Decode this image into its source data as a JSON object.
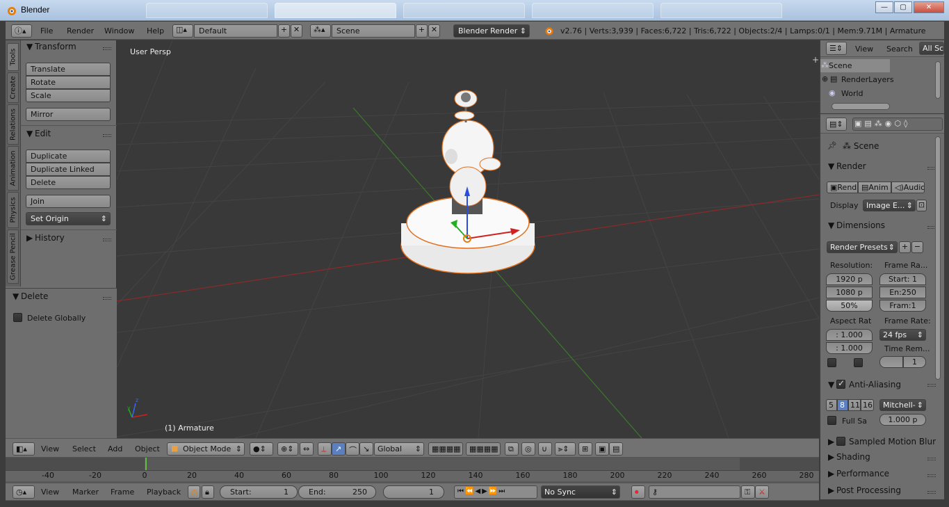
{
  "window": {
    "title": "Blender",
    "min": "—",
    "max": "▢",
    "close": "✕"
  },
  "infobar": {
    "menus": [
      "File",
      "Render",
      "Window",
      "Help"
    ],
    "layout": "Default",
    "scene": "Scene",
    "engine": "Blender Render",
    "stats": "v2.76 | Verts:3,939 | Faces:6,722 | Tris:6,722 | Objects:2/4 | Lamps:0/1 | Mem:9.71M | Armature"
  },
  "tool_tabs": [
    "Tools",
    "Create",
    "Relations",
    "Animation",
    "Physics",
    "Grease Pencil"
  ],
  "tools": {
    "transform_title": "Transform",
    "translate": "Translate",
    "rotate": "Rotate",
    "scale": "Scale",
    "mirror": "Mirror",
    "edit_title": "Edit",
    "duplicate": "Duplicate",
    "duplicate_linked": "Duplicate Linked",
    "delete": "Delete",
    "join": "Join",
    "set_origin": "Set Origin",
    "history_title": "History"
  },
  "operator": {
    "title": "Delete",
    "delete_globally": "Delete Globally"
  },
  "viewport": {
    "view_label": "User Persp",
    "selection": "(1) Armature"
  },
  "view3d_header": {
    "menus": [
      "View",
      "Select",
      "Add",
      "Object"
    ],
    "mode": "Object Mode",
    "orientation": "Global"
  },
  "timeline": {
    "ticks": [
      "-40",
      "-20",
      "0",
      "20",
      "40",
      "60",
      "80",
      "100",
      "120",
      "140",
      "160",
      "180",
      "200",
      "220",
      "240",
      "260",
      "280"
    ],
    "menus": [
      "View",
      "Marker",
      "Frame",
      "Playback"
    ],
    "start_label": "Start:",
    "start_value": "1",
    "end_label": "End:",
    "end_value": "250",
    "current": "1",
    "sync": "No Sync"
  },
  "outliner": {
    "menus": [
      "View",
      "Search"
    ],
    "filter": "All Sc",
    "items": [
      "Scene",
      "RenderLayers",
      "World"
    ]
  },
  "properties": {
    "context": "Scene",
    "render_title": "Render",
    "render_btn": "Rend",
    "anim_btn": "Anim",
    "audio_btn": "Audio",
    "display_label": "Display",
    "display_value": "Image E...",
    "dimensions_title": "Dimensions",
    "render_presets": "Render Presets",
    "resolution_label": "Resolution:",
    "res_x": "1920 p",
    "res_y": "1080 p",
    "res_pct": "50%",
    "frame_range_label": "Frame Ra...",
    "frame_start": "Start: 1",
    "frame_end": "En:250",
    "frame_step": "Fram:1",
    "aspect_label": "Aspect Rat",
    "aspect_x": ": 1.000",
    "aspect_y": ": 1.000",
    "frame_rate_label": "Frame Rate:",
    "frame_rate": "24 fps",
    "time_remap_label": "Time Rem...",
    "time_remap_val": "1",
    "aa_title": "Anti-Aliasing",
    "aa_samples": [
      "5",
      "8",
      "11",
      "16"
    ],
    "aa_filter": "Mitchell-",
    "full_sample": "Full Sa",
    "filter_size": "1.000 p",
    "sampled_motion_blur": "Sampled Motion Blur",
    "shading": "Shading",
    "performance": "Performance",
    "post_processing": "Post Processing"
  }
}
